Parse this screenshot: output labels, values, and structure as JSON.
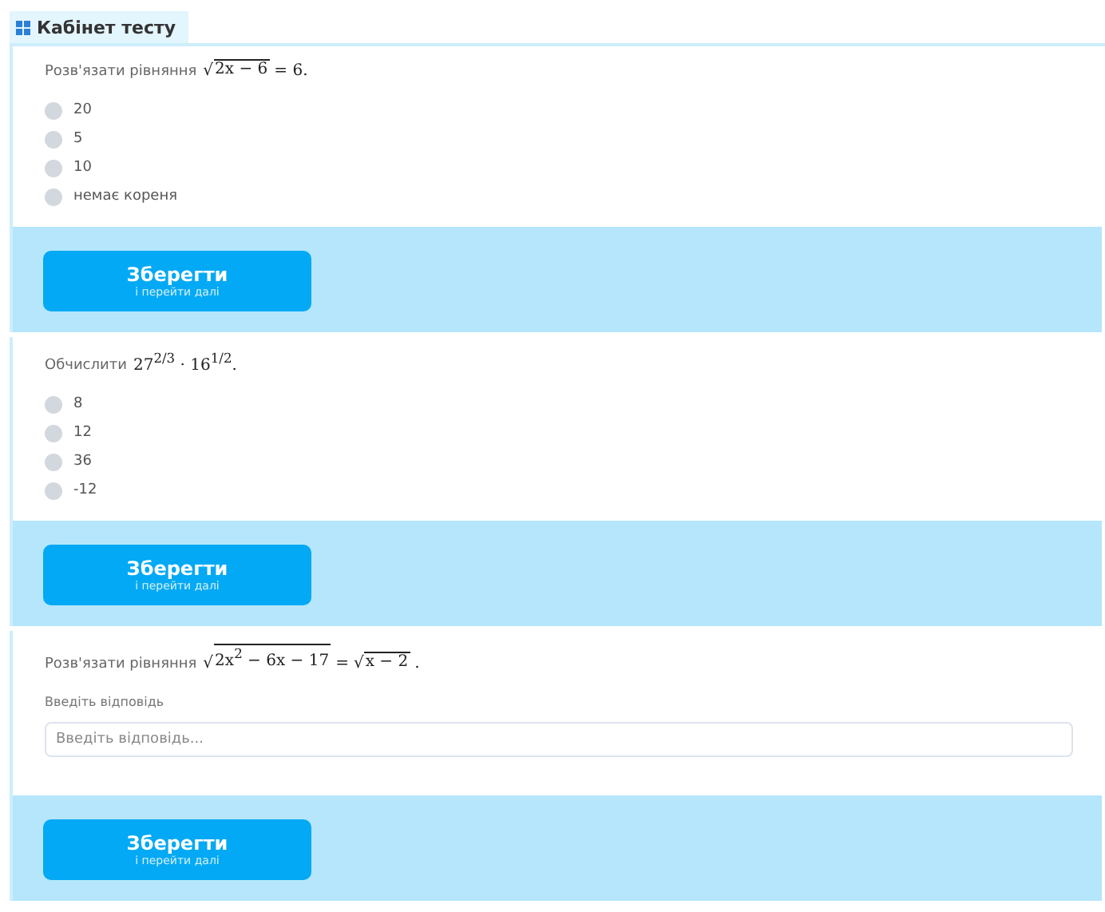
{
  "header": {
    "title": "Кабінет тесту"
  },
  "questions": [
    {
      "kind": "choice",
      "prompt": "Розв'язати рівняння",
      "math": [
        {
          "kind": "sqrt",
          "sign": "√",
          "body": "2x − 6"
        },
        {
          "kind": "text",
          "text": "= 6."
        }
      ],
      "options": [
        {
          "label": "20",
          "selected": false
        },
        {
          "label": "5",
          "selected": false
        },
        {
          "label": "10",
          "selected": false
        },
        {
          "label": "немає кореня",
          "selected": false
        }
      ],
      "button": {
        "label": "Зберегти",
        "sublabel": "і перейти далі"
      }
    },
    {
      "kind": "choice",
      "prompt": "Обчислити",
      "math": [
        {
          "kind": "text",
          "text": "27$^{2/3}$ · 16$^{1/2}$."
        }
      ],
      "options": [
        {
          "label": "8",
          "selected": false
        },
        {
          "label": "12",
          "selected": false
        },
        {
          "label": "36",
          "selected": false
        },
        {
          "label": "-12",
          "selected": false
        }
      ],
      "button": {
        "label": "Зберегти",
        "sublabel": "і перейти далі"
      }
    },
    {
      "kind": "input",
      "prompt": "Розв'язати рівняння",
      "math": [
        {
          "kind": "sqrt",
          "sign": "√",
          "body": "2x$^{2}$ − 6x − 17"
        },
        {
          "kind": "text",
          "text": "="
        },
        {
          "kind": "sqrt",
          "sign": "√",
          "body": "x − 2"
        },
        {
          "kind": "text",
          "text": "."
        }
      ],
      "field_label": "Введіть відповідь",
      "placeholder": "Введіть відповідь...",
      "button": {
        "label": "Зберегти",
        "sublabel": "і перейти далі"
      }
    }
  ]
}
